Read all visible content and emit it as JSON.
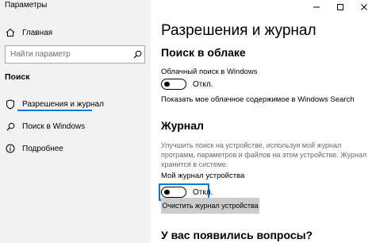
{
  "window": {
    "title": "Параметры",
    "controls": {
      "minimize": "minimize-icon",
      "maximize": "maximize-icon",
      "close": "close-icon"
    }
  },
  "sidebar": {
    "home": {
      "label": "Главная",
      "icon": "home-icon"
    },
    "search": {
      "placeholder": "Найти параметр",
      "icon": "search-icon"
    },
    "section_label": "Поиск",
    "items": [
      {
        "label": "Разрешения и журнал",
        "icon": "shield-icon",
        "active": true
      },
      {
        "label": "Поиск в Windows",
        "icon": "search-icon",
        "active": false
      },
      {
        "label": "Подробнее",
        "icon": "info-icon",
        "active": false
      }
    ]
  },
  "main": {
    "title": "Разрешения и журнал",
    "cloud_search": {
      "heading": "Поиск в облаке",
      "toggle_label": "Облачный поиск в Windows",
      "toggle_state": "Откл.",
      "link": "Показать мое облачное содержимое в Windows Search"
    },
    "history": {
      "heading": "Журнал",
      "description": "Улучшить поиск на устройстве, используя мой журнал программ, параметров и файлов на этом устройстве. Журнал хранится в системе.",
      "toggle_label": "Мой журнал устройства",
      "toggle_state": "Откл.",
      "clear_button": "Очистить журнал устройства"
    },
    "questions_heading": "У вас появились вопросы?"
  },
  "colors": {
    "accent": "#0078d7",
    "sidebar_bg": "#f2f2f2",
    "button_bg": "#cccccc"
  }
}
